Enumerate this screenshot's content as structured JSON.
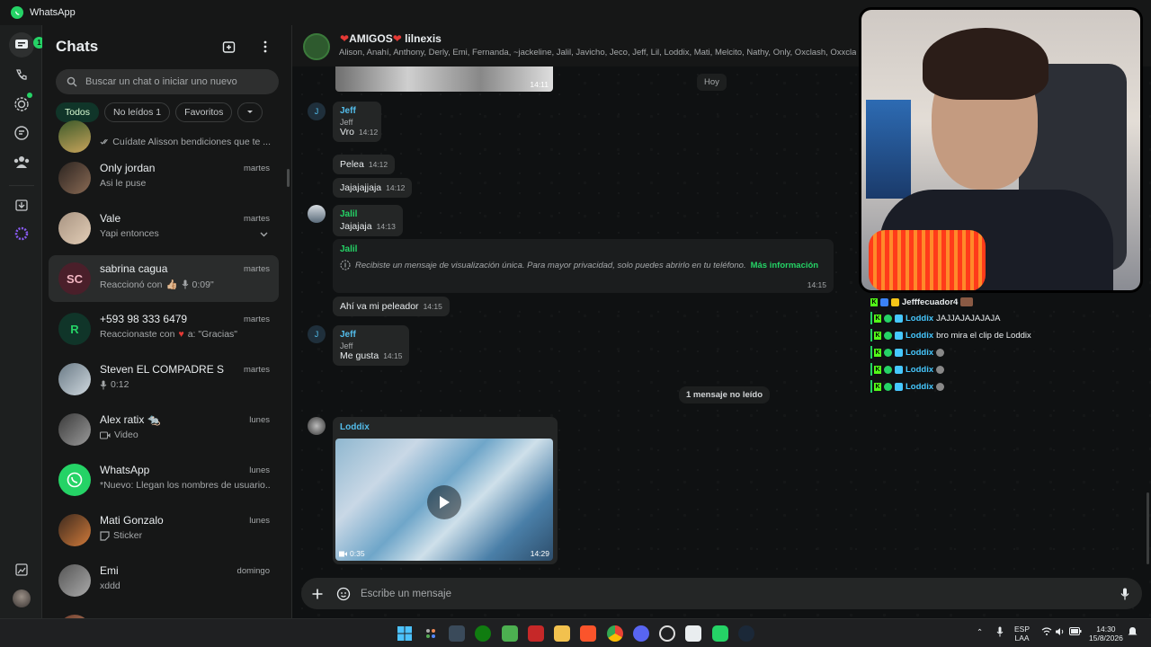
{
  "app": {
    "title": "WhatsApp"
  },
  "rail": {
    "badge_count": "1"
  },
  "sidebar": {
    "title": "Chats",
    "search_placeholder": "Buscar un chat o iniciar uno nuevo",
    "filters": [
      "Todos",
      "No leídos 1",
      "Favoritos"
    ],
    "chats": [
      {
        "name": "",
        "time": "",
        "preview": "Cuídate Alisson bendiciones que te ...",
        "avatar": ""
      },
      {
        "name": "Only jordan",
        "time": "martes",
        "preview": "Asi le puse",
        "avatar": ""
      },
      {
        "name": "Vale",
        "time": "martes",
        "preview": "Yapi entonces",
        "avatar": ""
      },
      {
        "name": "sabrina cagua",
        "time": "martes",
        "preview": "Reaccionó con",
        "preview_extra": "0:09\"",
        "avatar": "SC"
      },
      {
        "name": "+593 98 333 6479",
        "time": "martes",
        "preview": "Reaccionaste con",
        "preview_extra": "a: \"Gracias\"",
        "avatar": "R"
      },
      {
        "name": "Steven EL COMPADRE S",
        "time": "martes",
        "preview": "0:12",
        "avatar": ""
      },
      {
        "name": "Alex ratix",
        "time": "lunes",
        "preview": "Video",
        "avatar": ""
      },
      {
        "name": "WhatsApp",
        "time": "lunes",
        "preview": "*Nuevo: Llegan los nombres de usuario...",
        "avatar": ""
      },
      {
        "name": "Mati Gonzalo",
        "time": "lunes",
        "preview": "Sticker",
        "avatar": ""
      },
      {
        "name": "Emi",
        "time": "domingo",
        "preview": "xddd",
        "avatar": ""
      }
    ]
  },
  "chat": {
    "group_name": "AMIGOS",
    "group_name_suffix": "lilnexis",
    "members": "Alison, Anahí, Anthony, Derly, Emi, Fernanda, ~jackeline, Jalil, Javicho, Jeco, Jeff, Lil, Loddix, Mati, Melcito, Nathy, Only, Oxclash, Oxxclash",
    "day_label": "Hoy",
    "top_media_time": "14:11",
    "messages": [
      {
        "sender": "Jeff",
        "sub": "Jeff",
        "text": "Vro",
        "time": "14:12",
        "avatar": "J"
      },
      {
        "text": "Pelea",
        "time": "14:12"
      },
      {
        "text": "Jajajajjaja",
        "time": "14:12"
      },
      {
        "sender": "Jalil",
        "text": "Jajajaja",
        "time": "14:13"
      },
      {
        "sender": "Jalil",
        "text": "Recibiste un mensaje de visualización única. Para mayor privacidad, solo puedes abrirlo en tu teléfono.",
        "link": "Más información",
        "time": "14:15"
      },
      {
        "text": "Ahí va mi peleador",
        "time": "14:15"
      },
      {
        "sender": "Jeff",
        "sub": "Jeff",
        "text": "Me gusta",
        "time": "14:15",
        "avatar": "J"
      }
    ],
    "unread_divider": "1 mensaje no leído",
    "video": {
      "sender": "Loddix",
      "duration": "0:35",
      "time": "14:29"
    },
    "composer_placeholder": "Escribe un mensaje"
  },
  "stream_chat": [
    {
      "user": "Jefffecuador4",
      "text": ""
    },
    {
      "user": "Loddix",
      "text": "JAJJAJAJAJAJA"
    },
    {
      "user": "Loddix",
      "text": "bro mira el clip de Loddix"
    },
    {
      "user": "Loddix",
      "text": ""
    },
    {
      "user": "Loddix",
      "text": ""
    },
    {
      "user": "Loddix",
      "text": ""
    }
  ],
  "taskbar": {
    "lang1": "ESP",
    "lang2": "LAA",
    "time": "14:30",
    "date": "15/8/2026"
  },
  "colors": {
    "accent": "#25d366",
    "bg": "#0f1112",
    "bubble": "#242626",
    "jeff": "#53bdeb",
    "jalil": "#25d366",
    "loddix": "#53bdeb"
  }
}
